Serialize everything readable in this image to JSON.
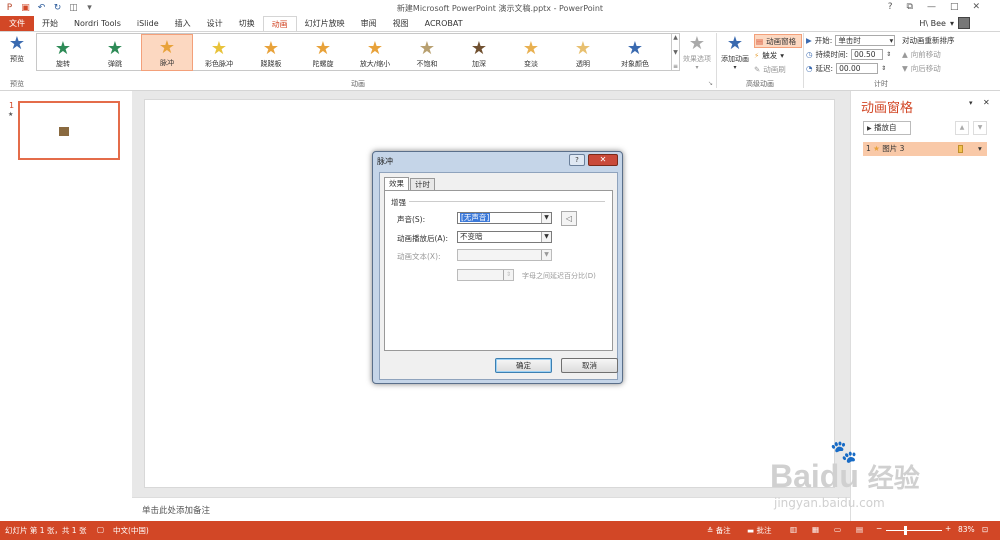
{
  "window": {
    "title": "新建Microsoft PowerPoint 演示文稿.pptx - PowerPoint",
    "help": "?",
    "restore": "⧉",
    "min": "—",
    "max": "□",
    "close": "✕"
  },
  "user": {
    "name": "H\\ Bee"
  },
  "tabs": [
    "文件",
    "开始",
    "Nordri Tools",
    "iSlide",
    "插入",
    "设计",
    "切换",
    "动画",
    "幻灯片放映",
    "审阅",
    "视图",
    "ACROBAT"
  ],
  "ribbon": {
    "preview_label": "预览",
    "preview_group": "预览",
    "effects": [
      {
        "label": "旋转",
        "color": "#2e8b57"
      },
      {
        "label": "弹跳",
        "color": "#2e8b57"
      },
      {
        "label": "脉冲",
        "color": "#e8a23a"
      },
      {
        "label": "彩色脉冲",
        "color": "#e8c23a"
      },
      {
        "label": "跷跷板",
        "color": "#e8a23a"
      },
      {
        "label": "陀螺旋",
        "color": "#e8a23a"
      },
      {
        "label": "放大/缩小",
        "color": "#e8a23a"
      },
      {
        "label": "不饱和",
        "color": "#b8a070"
      },
      {
        "label": "加深",
        "color": "#705030"
      },
      {
        "label": "变淡",
        "color": "#e8b050"
      },
      {
        "label": "透明",
        "color": "#e8c070"
      },
      {
        "label": "对象颜色",
        "color": "#3a6ab0"
      }
    ],
    "selected_effect": 2,
    "animation_group": "动画",
    "effect_options": "效果选项",
    "add_animation": "添加动画",
    "anim_pane_btn": "动画窗格",
    "trigger": "触发",
    "anim_painter": "动画刷",
    "advanced_group": "高级动画",
    "start_label": "开始:",
    "start_value": "单击时",
    "duration_label": "持续时间:",
    "duration_value": "00.50",
    "delay_label": "延迟:",
    "delay_value": "00.00",
    "reorder_label": "对动画重新排序",
    "move_earlier": "向前移动",
    "move_later": "向后移动",
    "timing_group": "计时"
  },
  "thumbs": {
    "slide_num": "1",
    "star": "★"
  },
  "notes": {
    "placeholder": "单击此处添加备注"
  },
  "pane": {
    "title": "动画窗格",
    "play_btn": "播放自",
    "item_index": "1",
    "item_name": "图片 3"
  },
  "dialog": {
    "title": "脉冲",
    "tab_effect": "效果",
    "tab_timing": "计时",
    "section": "增强",
    "sound_label": "声音(S):",
    "sound_value": "[无声音]",
    "after_label": "动画播放后(A):",
    "after_value": "不变暗",
    "text_label": "动画文本(X):",
    "text_value": "",
    "delay_pct_label": "字母之间延迟百分比(D)",
    "ok": "确定",
    "cancel": "取消"
  },
  "status": {
    "slide_info": "幻灯片 第 1 张，共 1 张",
    "language": "中文(中国)",
    "notes_btn": "备注",
    "comments_btn": "批注",
    "zoom": "83%"
  },
  "watermark": {
    "brand": "Baidu",
    "brand2": "经验",
    "url": "jingyan.baidu.com"
  }
}
